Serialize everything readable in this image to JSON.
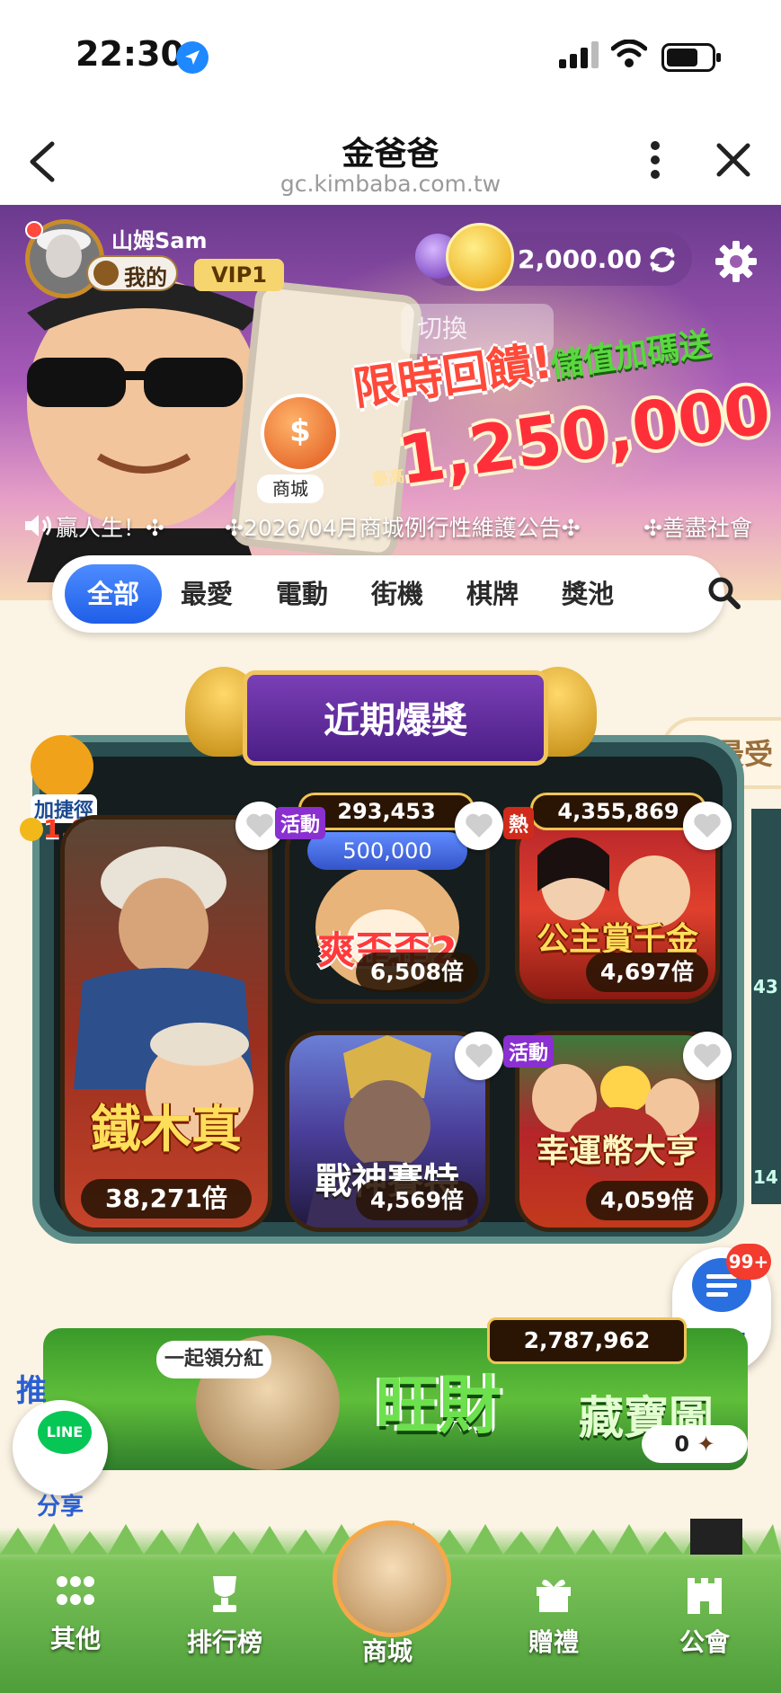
{
  "status_bar": {
    "time": "22:30"
  },
  "nav": {
    "title": "金爸爸",
    "url": "gc.kimbaba.com.tw"
  },
  "user": {
    "name": "山姆Sam",
    "mine_label": "我的",
    "vip": "VIP1",
    "coins": "2,000.00"
  },
  "promo": {
    "switch_ghost": "切換",
    "headline": "限時回饋!",
    "tagline": "儲值加碼送",
    "max_prefix": "最高",
    "amount": "1,250,000",
    "shop_label": "商城"
  },
  "marquee": {
    "left": "贏人生！✣",
    "middle": "✣2026/04月商城例行性維護公告✣",
    "right": "✣善盡社會"
  },
  "tabs": [
    "全部",
    "最愛",
    "電動",
    "街機",
    "棋牌",
    "獎池"
  ],
  "section": {
    "title": "近期爆獎",
    "peek_title": "最受",
    "peek_values": [
      "43",
      "14"
    ]
  },
  "shortcut": {
    "label": "加捷徑",
    "reward": "1,000"
  },
  "games": {
    "big": {
      "title": "鐵木真",
      "multiplier": "38,271倍"
    },
    "g1": {
      "title": "爽歪歪2",
      "tag": "活動",
      "jackpot": "293,453",
      "bonus": "500,000",
      "multiplier": "6,508倍"
    },
    "g2": {
      "title": "公主賞千金",
      "tag": "熱",
      "jackpot": "4,355,869",
      "multiplier": "4,697倍"
    },
    "g3": {
      "title": "戰神賽特",
      "multiplier": "4,569倍"
    },
    "g4": {
      "title": "幸運幣大亨",
      "tag": "活動",
      "multiplier": "4,059倍"
    }
  },
  "chat": {
    "label": "聊天",
    "badge": "99+"
  },
  "banner2": {
    "tag": "一起領分紅",
    "title": "旺財",
    "subtitle": "藏寶圖",
    "jackpot": "2,787,962",
    "count": "0"
  },
  "share": {
    "tui": "推",
    "line": "LINE",
    "label": "分享"
  },
  "bottom_nav": {
    "other": "其他",
    "rank": "排行榜",
    "shop": "商城",
    "gift": "贈禮",
    "guild": "公會"
  }
}
